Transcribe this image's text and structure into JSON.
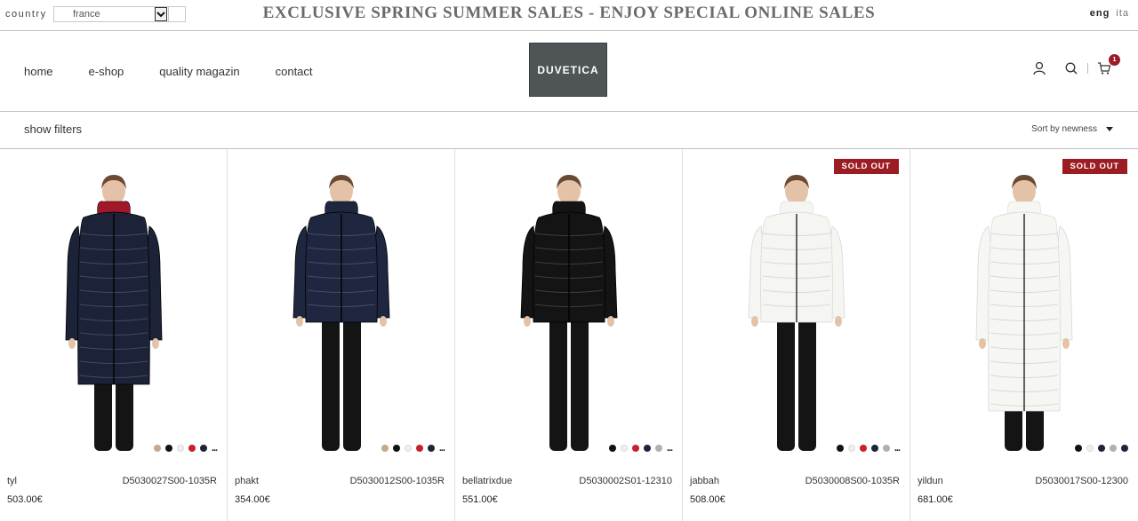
{
  "topbar": {
    "country_label": "country",
    "country_value": "france",
    "promo": "EXCLUSIVE SPRING SUMMER SALES - ENJOY SPECIAL ONLINE SALES",
    "lang_active": "eng",
    "lang_other": "ita"
  },
  "header": {
    "nav": [
      "home",
      "e-shop",
      "quality magazin",
      "contact"
    ],
    "logo": "DUVETICA",
    "cart_count": "1",
    "icons": [
      "user-icon",
      "search-icon",
      "cart-icon"
    ]
  },
  "filterbar": {
    "show_filters": "show filters",
    "sort_label": "Sort by newness"
  },
  "colors": {
    "sold_out": "#9b1c23",
    "logo_bg": "#4f5457"
  },
  "products": [
    {
      "name": "tyl",
      "code": "D5030027S00-1035R",
      "price": "503.00€",
      "sold_out": false,
      "sold_out_label": "",
      "jacket": "#1c2338",
      "lining": "#a3172b",
      "length": "long",
      "swatches": [
        "#c4a98c",
        "#111111",
        "#eeeeee",
        "#c8202f",
        "#1d2438"
      ],
      "more": "..."
    },
    {
      "name": "phakt",
      "code": "D5030012S00-1035R",
      "price": "354.00€",
      "sold_out": false,
      "sold_out_label": "",
      "jacket": "#1f2740",
      "lining": "#1f2740",
      "length": "short",
      "swatches": [
        "#c4a98c",
        "#111111",
        "#eeeeee",
        "#c8202f",
        "#1d2438"
      ],
      "more": "..."
    },
    {
      "name": "bellatrixdue",
      "code": "D5030002S01-12310",
      "price": "551.00€",
      "sold_out": false,
      "sold_out_label": "",
      "jacket": "#141414",
      "lining": "#141414",
      "length": "short",
      "swatches": [
        "#111111",
        "#eeeeee",
        "#c8202f",
        "#1d2438",
        "#b0b0b0"
      ],
      "more": "..."
    },
    {
      "name": "jabbah",
      "code": "D5030008S00-1035R",
      "price": "508.00€",
      "sold_out": true,
      "sold_out_label": "SOLD OUT",
      "jacket": "#f5f5f2",
      "lining": "#f5f5f2",
      "length": "short",
      "swatches": [
        "#111111",
        "#eeeeee",
        "#c8202f",
        "#1d2438",
        "#b0b0b0"
      ],
      "more": "..."
    },
    {
      "name": "yildun",
      "code": "D5030017S00-12300",
      "price": "681.00€",
      "sold_out": true,
      "sold_out_label": "SOLD OUT",
      "jacket": "#f6f6f3",
      "lining": "#f6f6f3",
      "length": "maxi",
      "swatches": [
        "#111111",
        "#eeeeee",
        "#1d2438",
        "#b0b0b0",
        "#1d2438"
      ],
      "more": ""
    }
  ]
}
